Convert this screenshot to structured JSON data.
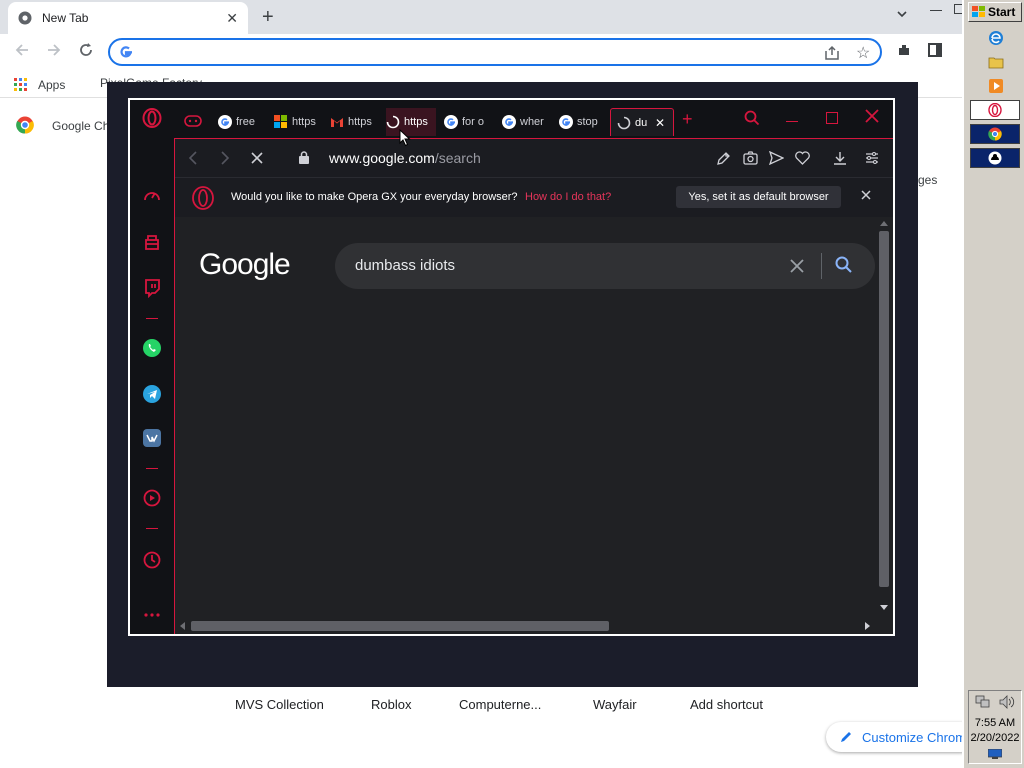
{
  "chrome": {
    "tab_title": "New Tab",
    "bookmarks": {
      "apps": "Apps",
      "item2": "PixelGame Factory"
    },
    "google_chip": "Google Ch",
    "side_text": "ges",
    "shortcuts": [
      "MVS Collection",
      "Roblox",
      "Computerne...",
      "Wayfair",
      "Add shortcut"
    ],
    "customize": "Customize Chrom"
  },
  "opera": {
    "tabs": [
      {
        "label": "free",
        "icon": "google-icon"
      },
      {
        "label": "https",
        "icon": "microsoft-icon"
      },
      {
        "label": "https",
        "icon": "gmail-icon"
      },
      {
        "label": "https",
        "icon": "loading-icon"
      },
      {
        "label": "for o",
        "icon": "google-icon"
      },
      {
        "label": "wher",
        "icon": "google-icon"
      },
      {
        "label": "stop",
        "icon": "google-icon"
      },
      {
        "label": "du",
        "icon": "loading-icon"
      }
    ],
    "address": {
      "domain": "www.google.com",
      "path": "/search"
    },
    "banner": {
      "question": "Would you like to make Opera GX your everyday browser?",
      "link": "How do I do that?",
      "button": "Yes, set it as default browser"
    },
    "google_logo": "Google",
    "search_query": "dumbass idiots"
  },
  "taskbar": {
    "start": "Start",
    "time": "7:55 AM",
    "date": "2/20/2022"
  },
  "colors": {
    "accent": "#d6163e",
    "chrome_blue": "#1a73e8",
    "taskbar": "#d4d0c8"
  }
}
